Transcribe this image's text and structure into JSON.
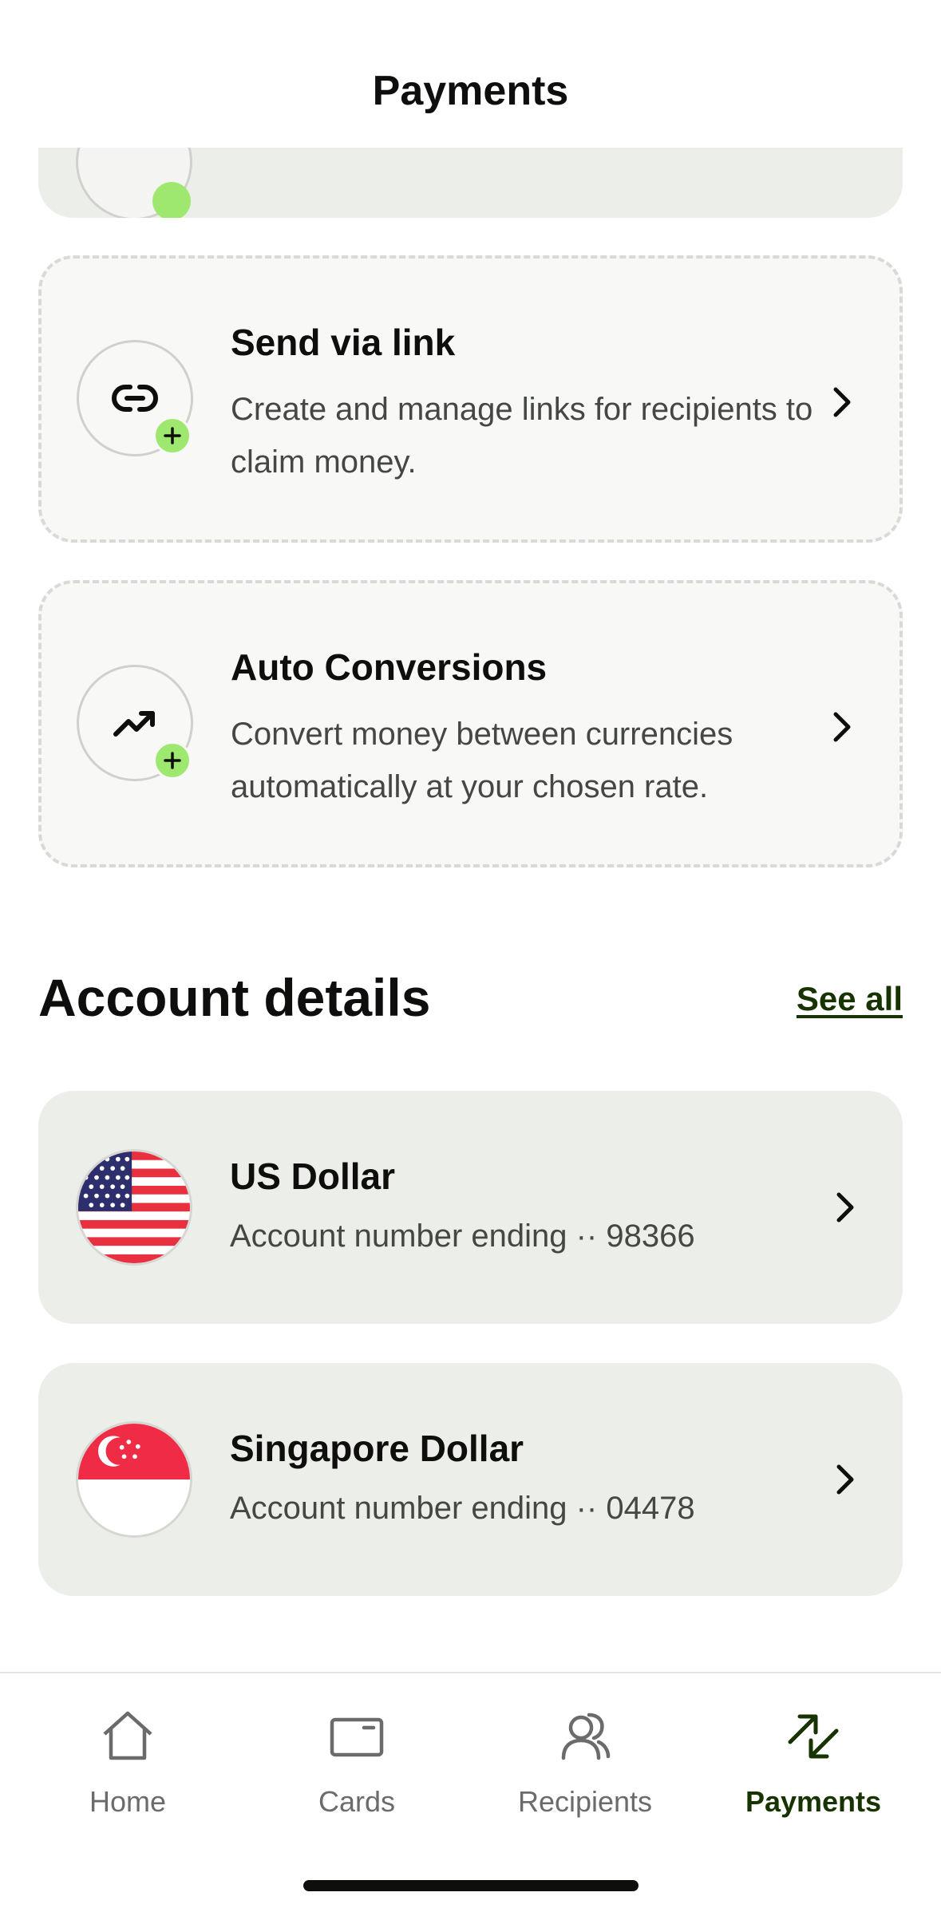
{
  "header": {
    "title": "Payments"
  },
  "features": [
    {
      "title": "Send via link",
      "description": "Create and manage links for recipients to claim money.",
      "icon": "link-icon"
    },
    {
      "title": "Auto Conversions",
      "description": "Convert money between currencies automatically at your chosen rate.",
      "icon": "trending-up-icon"
    }
  ],
  "account_details": {
    "title": "Account details",
    "see_all_label": "See all",
    "accounts": [
      {
        "currency": "US Dollar",
        "detail": "Account number ending ·· 98366",
        "flag": "us-flag-icon"
      },
      {
        "currency": "Singapore Dollar",
        "detail": "Account number ending ·· 04478",
        "flag": "sg-flag-icon"
      }
    ]
  },
  "nav": {
    "items": [
      {
        "label": "Home",
        "icon": "home-icon",
        "active": false
      },
      {
        "label": "Cards",
        "icon": "card-icon",
        "active": false
      },
      {
        "label": "Recipients",
        "icon": "recipients-icon",
        "active": false
      },
      {
        "label": "Payments",
        "icon": "payments-icon",
        "active": true
      }
    ]
  },
  "colors": {
    "accent_green": "#9fe870",
    "active_nav": "#163300",
    "card_bg": "#eceeea"
  }
}
